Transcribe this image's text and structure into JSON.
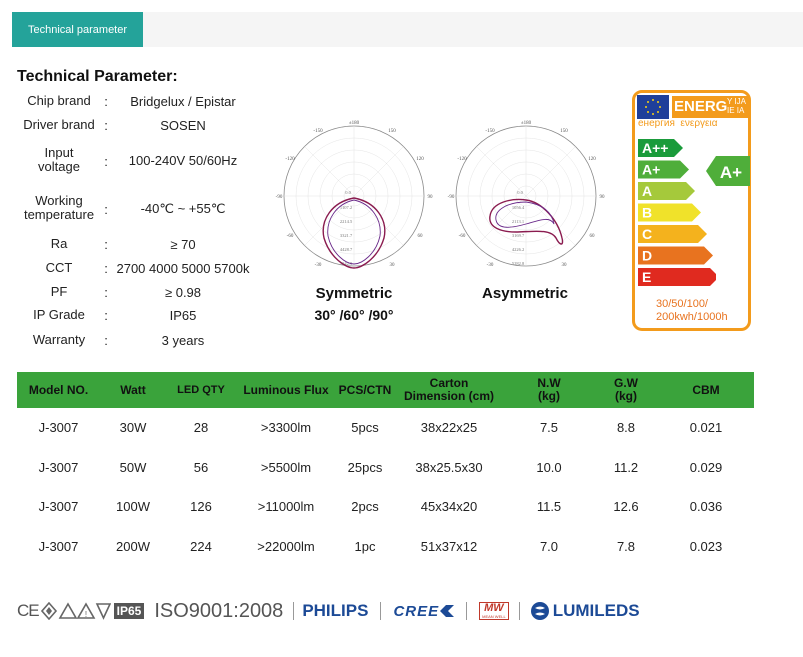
{
  "tab": {
    "label": "Technical parameter"
  },
  "section_title": "Technical Parameter:",
  "specs": [
    {
      "label": "Chip brand",
      "value": "Bridgelux / Epistar"
    },
    {
      "label": "Driver brand",
      "value": "SOSEN"
    },
    {
      "label": "Input voltage",
      "value": "100-240V 50/60Hz"
    },
    {
      "label": "Working temperature",
      "value": "-40℃ ~ +55℃"
    },
    {
      "label": "Ra",
      "value": "≥ 70"
    },
    {
      "label": "CCT",
      "value": "2700 4000 5000 5700k"
    },
    {
      "label": "PF",
      "value": "≥ 0.98"
    },
    {
      "label": "IP Grade",
      "value": "IP65"
    },
    {
      "label": "Warranty",
      "value": "3 years"
    }
  ],
  "polar": {
    "angle_labels": [
      "±180",
      "-150",
      "150",
      "-120",
      "120",
      "-90",
      "90",
      "-60",
      "60",
      "-30",
      "30",
      "0"
    ],
    "symmetric": {
      "caption": "Symmetric",
      "sub": "30° /60° /90°",
      "radial_labels": [
        "0.0",
        "1107.2",
        "2214.5",
        "3321.7",
        "4428.7",
        "5542.9"
      ]
    },
    "asymmetric": {
      "caption": "Asymmetric",
      "radial_labels": [
        "0.0",
        "1056.4",
        "2113.1",
        "3169.7",
        "4226.2",
        "5282.8"
      ]
    }
  },
  "energy_label": {
    "title_energ": "ENERG",
    "title_y": "Y IJA",
    "title_ie": "IE IA",
    "title_line2": "енергия  ενεργεια",
    "classes": [
      "A++",
      "A+",
      "A",
      "B",
      "C",
      "D",
      "E"
    ],
    "class_colors": [
      "#1a9b3b",
      "#4fae3a",
      "#a5c93b",
      "#f0e22a",
      "#f4b21d",
      "#e8731f",
      "#e02a1f"
    ],
    "rating": "A+",
    "rating_color": "#4fae3a",
    "footer_line1": "30/50/100/",
    "footer_line2": "200kwh/1000h"
  },
  "table": {
    "headers": [
      "Model NO.",
      "Watt",
      "LED QTY",
      "Luminous Flux",
      "PCS/CTN",
      "Carton Dimension (cm)",
      "N.W (kg)",
      "G.W (kg)",
      "CBM"
    ],
    "rows": [
      [
        "J-3007",
        "30W",
        "28",
        ">3300lm",
        "5pcs",
        "38x22x25",
        "7.5",
        "8.8",
        "0.021"
      ],
      [
        "J-3007",
        "50W",
        "56",
        ">5500lm",
        "25pcs",
        "38x25.5x30",
        "10.0",
        "11.2",
        "0.029"
      ],
      [
        "J-3007",
        "100W",
        "126",
        ">11000lm",
        "2pcs",
        "45x34x20",
        "11.5",
        "12.6",
        "0.036"
      ],
      [
        "J-3007",
        "200W",
        "224",
        ">22000lm",
        "1pc",
        "51x37x12",
        "7.0",
        "7.8",
        "0.023"
      ]
    ]
  },
  "certs": {
    "ce": "CE",
    "ip65": "IP65",
    "iso": "ISO9001:2008",
    "philips": "PHILIPS",
    "cree": "CREE",
    "mw": "MW",
    "mw_sub": "MEAN WELL",
    "lumileds": "LUMILEDS"
  }
}
